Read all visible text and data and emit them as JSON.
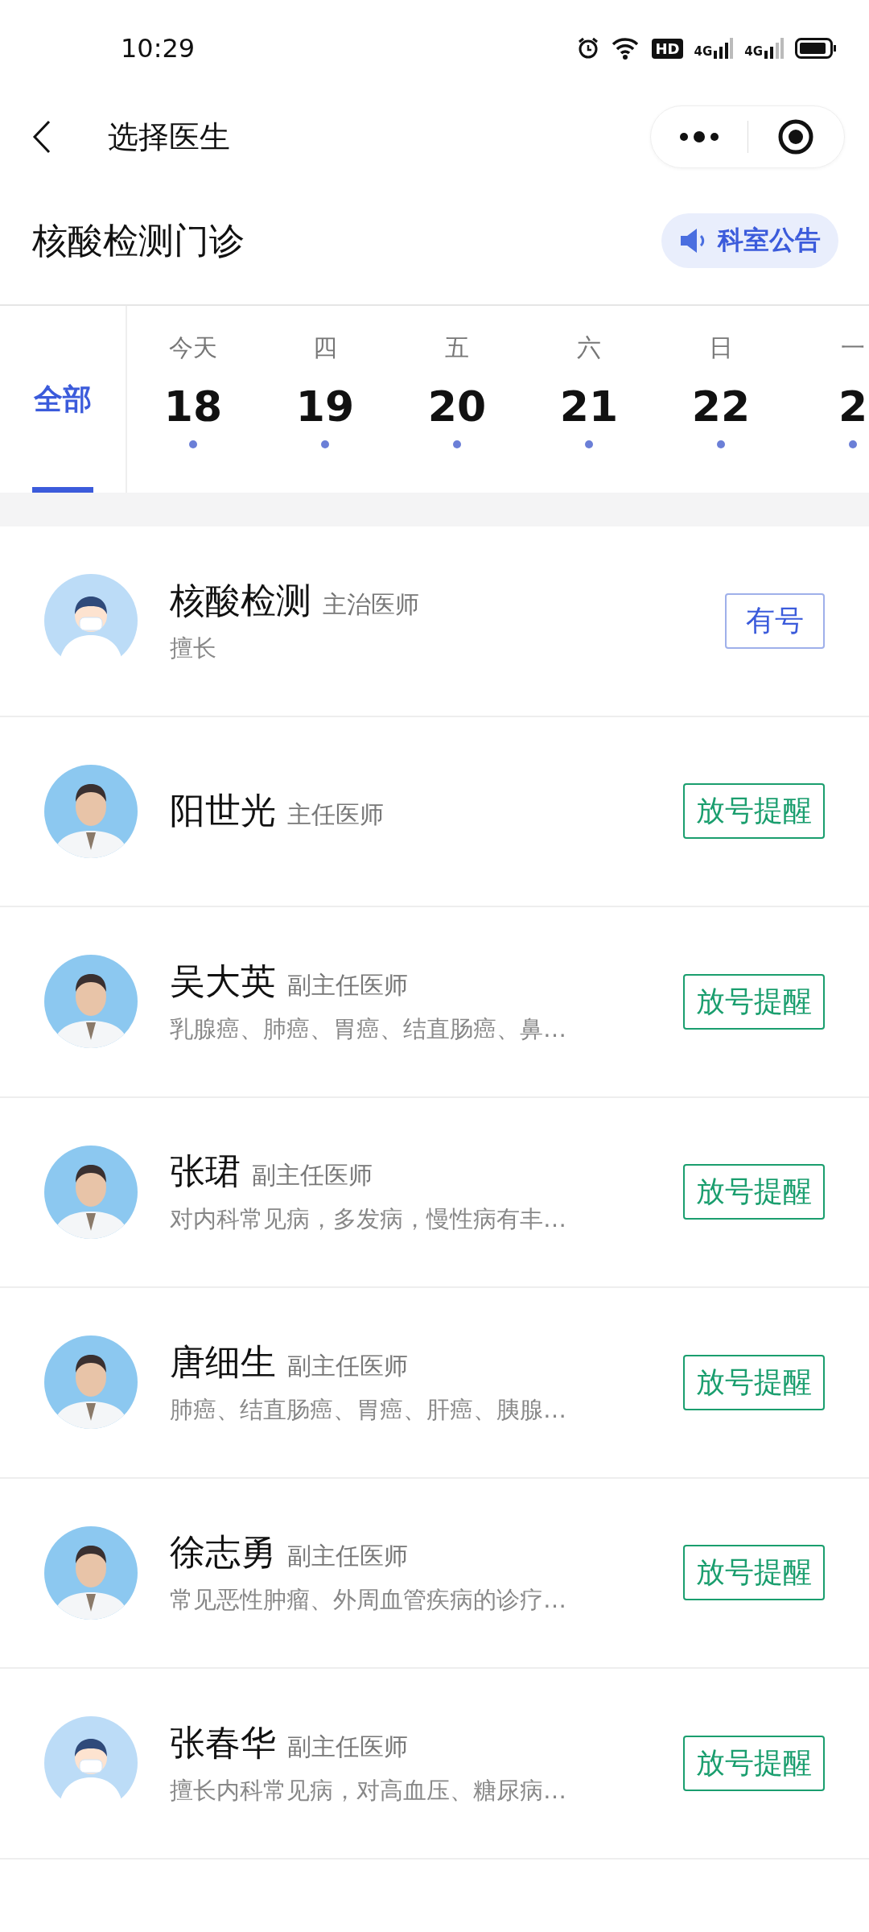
{
  "status_bar": {
    "time": "10:29",
    "hd_label": "HD",
    "network_labels": [
      "4G",
      "4G"
    ]
  },
  "nav": {
    "title": "选择医生"
  },
  "department": {
    "name": "核酸检测门诊",
    "notice_button": "科室公告"
  },
  "date_tabs": {
    "all": {
      "label": "全部",
      "selected": true
    },
    "days": [
      {
        "weekday": "今天",
        "date": "18",
        "has_slots": true,
        "selected": false
      },
      {
        "weekday": "四",
        "date": "19",
        "has_slots": true,
        "selected": false
      },
      {
        "weekday": "五",
        "date": "20",
        "has_slots": true,
        "selected": false
      },
      {
        "weekday": "六",
        "date": "21",
        "has_slots": true,
        "selected": false
      },
      {
        "weekday": "日",
        "date": "22",
        "has_slots": true,
        "selected": false
      },
      {
        "weekday": "一",
        "date": "2",
        "has_slots": true,
        "selected": false
      }
    ]
  },
  "doctors": [
    {
      "name": "核酸检测",
      "title": "主治医师",
      "specialty": "擅长",
      "avatar": {
        "kind": "default"
      },
      "action": {
        "kind": "available",
        "label": "有号"
      }
    },
    {
      "name": "阳世光",
      "title": "主任医师",
      "action": {
        "kind": "reminder",
        "label": "放号提醒"
      }
    },
    {
      "name": "吴大英",
      "title": "副主任医师",
      "specialty": "乳腺癌、肺癌、胃癌、结直肠癌、鼻…",
      "action": {
        "kind": "reminder",
        "label": "放号提醒"
      }
    },
    {
      "name": "张珺",
      "title": "副主任医师",
      "specialty": "对内科常见病，多发病，慢性病有丰…",
      "action": {
        "kind": "reminder",
        "label": "放号提醒"
      }
    },
    {
      "name": "唐细生",
      "title": "副主任医师",
      "specialty": "肺癌、结直肠癌、胃癌、肝癌、胰腺…",
      "action": {
        "kind": "reminder",
        "label": "放号提醒"
      }
    },
    {
      "name": "徐志勇",
      "title": "副主任医师",
      "specialty": "常见恶性肿瘤、外周血管疾病的诊疗…",
      "action": {
        "kind": "reminder",
        "label": "放号提醒"
      }
    },
    {
      "name": "张春华",
      "title": "副主任医师",
      "specialty": "擅长内科常见病，对高血压、糖尿病…",
      "avatar": {
        "kind": "default"
      },
      "action": {
        "kind": "reminder",
        "label": "放号提醒"
      }
    }
  ]
}
